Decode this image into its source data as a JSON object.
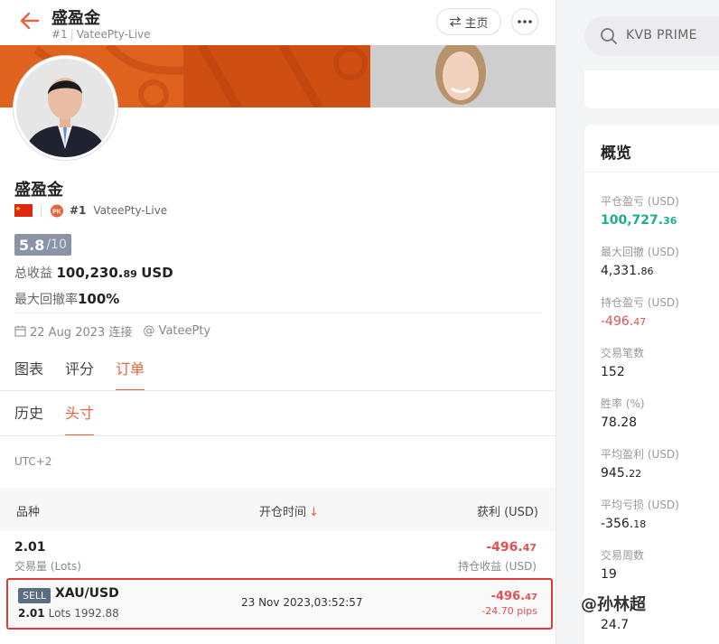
{
  "header": {
    "title": "盛盈金",
    "rank": "#1",
    "account": "VateePty-Live",
    "home_label": "主页"
  },
  "profile": {
    "name": "盛盈金",
    "rank": "#1",
    "account": "VateePty-Live",
    "score": "5.8",
    "score_max": "/10",
    "total_profit_label": "总收益",
    "total_profit_main": "100,230.",
    "total_profit_cents": "89",
    "total_profit_unit": "USD",
    "max_drawdown_label": "最大回撤率",
    "max_drawdown_value": "100%",
    "join_date": "22 Aug 2023 连接",
    "broker": "@ VateePty"
  },
  "tabs": [
    "图表",
    "评分",
    "订单"
  ],
  "active_tab": 2,
  "subtabs": [
    "历史",
    "头寸"
  ],
  "active_subtab": 1,
  "timezone": "UTC+2",
  "table": {
    "col_symbol": "品种",
    "col_open_time": "开仓时间",
    "col_profit": "获利 (USD)",
    "summary": {
      "lots": "2.01",
      "lots_label": "交易量 (Lots)",
      "pnl_main": "-496.",
      "pnl_cents": "47",
      "pnl_label": "持仓收益 (USD)"
    },
    "order": {
      "side": "SELL",
      "symbol": "XAU/USD",
      "lots": "2.01",
      "lots_text": "Lots 1992.88",
      "open_time": "23 Nov 2023,03:52:57",
      "pnl_main": "-496.",
      "pnl_cents": "47",
      "pips": "-24.70 pips"
    }
  },
  "side": {
    "search_text": "KVB PRIME",
    "overview_title": "概览",
    "stats": [
      {
        "label": "平仓盈亏 (USD)",
        "main": "100,727.",
        "cents": "36"
      },
      {
        "label": "最大回撤 (USD)",
        "main": "4,331.",
        "cents": "86"
      },
      {
        "label": "持仓盈亏 (USD)",
        "main": "-496.",
        "cents": "47"
      },
      {
        "label": "交易笔数",
        "main": "152",
        "cents": ""
      },
      {
        "label": "胜率 (%)",
        "main": "78.28",
        "cents": ""
      },
      {
        "label": "平均盈利 (USD)",
        "main": "945.",
        "cents": "22"
      },
      {
        "label": "平均亏损 (USD)",
        "main": "-356.",
        "cents": "18"
      },
      {
        "label": "交易周数",
        "main": "19",
        "cents": ""
      },
      {
        "label": "",
        "main": "24.7",
        "cents": ""
      }
    ]
  },
  "watermark": "@孙林超",
  "colors": {
    "accent": "#e8633a",
    "profit_green": "#1aae8b",
    "loss_red": "#e05252",
    "highlight_border": "#e23a3a"
  }
}
